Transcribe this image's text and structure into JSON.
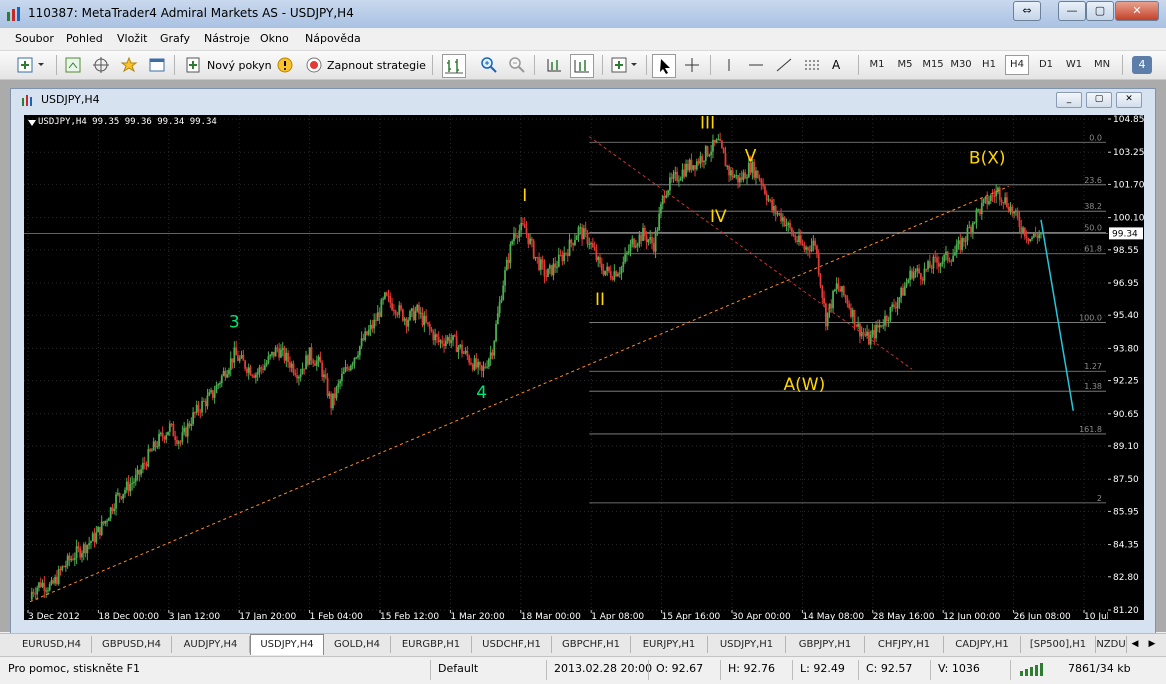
{
  "window": {
    "title": "110387: MetaTrader4 Admiral Markets AS - USDJPY,H4"
  },
  "menu": [
    "Soubor",
    "Pohled",
    "Vložit",
    "Grafy",
    "Nástroje",
    "Okno",
    "Nápověda"
  ],
  "toolbar": {
    "new_order_label": "Nový pokyn",
    "strategy_label": "Zapnout strategie",
    "timeframes": [
      "M1",
      "M5",
      "M15",
      "M30",
      "H1",
      "H4",
      "D1",
      "W1",
      "MN"
    ],
    "active_timeframe": "H4",
    "notification_count": "4"
  },
  "chart_window": {
    "title": "USDJPY,H4",
    "header": "USDJPY,H4  99.35 99.36 99.34 99.34"
  },
  "chart_data": {
    "type": "candlestick",
    "symbol": "USDJPY",
    "timeframe": "H4",
    "ohlc_header": [
      99.35,
      99.36,
      99.34,
      99.34
    ],
    "current_price": "99.34",
    "ylim": [
      81.2,
      104.85
    ],
    "y_ticks": [
      "104.85",
      "103.25",
      "101.70",
      "100.10",
      "98.55",
      "96.95",
      "95.40",
      "93.80",
      "92.25",
      "90.65",
      "89.10",
      "87.50",
      "85.95",
      "84.35",
      "82.80",
      "81.20"
    ],
    "x_ticks": [
      "3 Dec 2012",
      "18 Dec 00:00",
      "3 Jan 12:00",
      "17 Jan 20:00",
      "1 Feb 04:00",
      "15 Feb 12:00",
      "1 Mar 20:00",
      "18 Mar 00:00",
      "1 Apr 08:00",
      "15 Apr 16:00",
      "30 Apr 00:00",
      "14 May 08:00",
      "28 May 16:00",
      "12 Jun 00:00",
      "26 Jun 08:00",
      "10 Jul 16:00"
    ],
    "close_path": [
      [
        0,
        82.0
      ],
      [
        1,
        82.5
      ],
      [
        2,
        82.3
      ],
      [
        3,
        83.2
      ],
      [
        4,
        83.8
      ],
      [
        5,
        84.2
      ],
      [
        6,
        84.7
      ],
      [
        7,
        85.5
      ],
      [
        8,
        86.6
      ],
      [
        9,
        87.1
      ],
      [
        10,
        87.6
      ],
      [
        11,
        88.6
      ],
      [
        12,
        89.4
      ],
      [
        13,
        90.0
      ],
      [
        14,
        89.3
      ],
      [
        15,
        90.4
      ],
      [
        16,
        91.1
      ],
      [
        17,
        91.6
      ],
      [
        18,
        92.6
      ],
      [
        19,
        93.5
      ],
      [
        20,
        93.0
      ],
      [
        21,
        92.6
      ],
      [
        22,
        93.1
      ],
      [
        23,
        93.8
      ],
      [
        24,
        93.2
      ],
      [
        25,
        92.6
      ],
      [
        26,
        93.5
      ],
      [
        27,
        93.0
      ],
      [
        28,
        91.1
      ],
      [
        29,
        92.4
      ],
      [
        30,
        93.3
      ],
      [
        31,
        94.2
      ],
      [
        32,
        95.0
      ],
      [
        33,
        96.2
      ],
      [
        34,
        95.8
      ],
      [
        35,
        95.2
      ],
      [
        36,
        95.6
      ],
      [
        37,
        94.8
      ],
      [
        38,
        94.1
      ],
      [
        39,
        94.3
      ],
      [
        40,
        93.8
      ],
      [
        41,
        93.2
      ],
      [
        42,
        92.6
      ],
      [
        43,
        93.8
      ],
      [
        44,
        97.0
      ],
      [
        45,
        99.4
      ],
      [
        46,
        99.6
      ],
      [
        47,
        98.2
      ],
      [
        48,
        97.3
      ],
      [
        49,
        97.9
      ],
      [
        50,
        98.6
      ],
      [
        51,
        99.5
      ],
      [
        52,
        99.0
      ],
      [
        53,
        97.7
      ],
      [
        54,
        97.4
      ],
      [
        55,
        97.7
      ],
      [
        56,
        98.9
      ],
      [
        57,
        99.3
      ],
      [
        58,
        98.8
      ],
      [
        59,
        101.4
      ],
      [
        60,
        102.0
      ],
      [
        61,
        102.5
      ],
      [
        62,
        102.8
      ],
      [
        63,
        103.3
      ],
      [
        64,
        103.7
      ],
      [
        65,
        102.3
      ],
      [
        66,
        101.9
      ],
      [
        67,
        102.6
      ],
      [
        68,
        101.9
      ],
      [
        69,
        100.5
      ],
      [
        70,
        100.1
      ],
      [
        71,
        99.2
      ],
      [
        72,
        98.6
      ],
      [
        73,
        98.9
      ],
      [
        74,
        95.2
      ],
      [
        75,
        96.8
      ],
      [
        76,
        96.1
      ],
      [
        77,
        94.8
      ],
      [
        78,
        94.2
      ],
      [
        79,
        94.9
      ],
      [
        80,
        95.6
      ],
      [
        81,
        96.4
      ],
      [
        82,
        97.5
      ],
      [
        83,
        97.4
      ],
      [
        84,
        97.9
      ],
      [
        85,
        98.1
      ],
      [
        86,
        98.4
      ],
      [
        87,
        99.2
      ],
      [
        88,
        100.3
      ],
      [
        89,
        100.9
      ],
      [
        90,
        101.4
      ],
      [
        91,
        100.7
      ],
      [
        92,
        99.8
      ],
      [
        93,
        99.1
      ],
      [
        94,
        99.34
      ]
    ],
    "fibonacci_levels": [
      {
        "label": "0.0",
        "price": 103.73
      },
      {
        "label": "23.6",
        "price": 101.68
      },
      {
        "label": "38.2",
        "price": 100.41
      },
      {
        "label": "50.0",
        "price": 99.38
      },
      {
        "label": "61.8",
        "price": 98.36
      },
      {
        "label": "100.0",
        "price": 95.05
      },
      {
        "label": "1.27",
        "price": 92.7
      },
      {
        "label": "1.38",
        "price": 91.74
      },
      {
        "label": "161.8",
        "price": 89.68
      },
      {
        "label": "2",
        "price": 86.36
      }
    ],
    "wave_labels": [
      {
        "text": "3",
        "color": "#00e676",
        "x": 19,
        "y": 94.8
      },
      {
        "text": "4",
        "color": "#00e676",
        "x": 42,
        "y": 91.4
      },
      {
        "text": "I",
        "color": "#ffd600",
        "x": 46,
        "y": 100.9
      },
      {
        "text": "II",
        "color": "#ffd600",
        "x": 53,
        "y": 95.9
      },
      {
        "text": "III",
        "color": "#ffd600",
        "x": 63,
        "y": 104.4
      },
      {
        "text": "IV",
        "color": "#ffd600",
        "x": 64,
        "y": 99.9
      },
      {
        "text": "V",
        "color": "#ffd600",
        "x": 67,
        "y": 102.8
      },
      {
        "text": "A(W)",
        "color": "#ffd600",
        "x": 72,
        "y": 91.8
      },
      {
        "text": "B(X)",
        "color": "#ffd600",
        "x": 89,
        "y": 102.7
      }
    ],
    "trendline": {
      "from": [
        0,
        81.6
      ],
      "to": [
        91,
        101.6
      ],
      "color": "#ff8c1a"
    },
    "channel_line": {
      "from": [
        52,
        104.0
      ],
      "to": [
        82,
        92.8
      ],
      "color": "#d32f2f"
    },
    "projection": {
      "from": [
        94,
        100.0
      ],
      "to": [
        97,
        90.8
      ],
      "color": "#26c6da"
    }
  },
  "symbol_tabs": [
    "EURUSD,H4",
    "GBPUSD,H4",
    "AUDJPY,H4",
    "USDJPY,H4",
    "GOLD,H4",
    "EURGBP,H1",
    "USDCHF,H1",
    "GBPCHF,H1",
    "EURJPY,H1",
    "USDJPY,H1",
    "GBPJPY,H1",
    "CHFJPY,H1",
    "CADJPY,H1",
    "[SP500],H1",
    "NZDU"
  ],
  "active_tab": "USDJPY,H4",
  "status": {
    "help": "Pro pomoc, stiskněte F1",
    "profile": "Default",
    "datetime": "2013.02.28 20:00",
    "open": "O: 92.67",
    "high": "H: 92.76",
    "low": "L: 92.49",
    "close": "C: 92.57",
    "volume": "V: 1036",
    "traffic": "7861/34 kb"
  }
}
